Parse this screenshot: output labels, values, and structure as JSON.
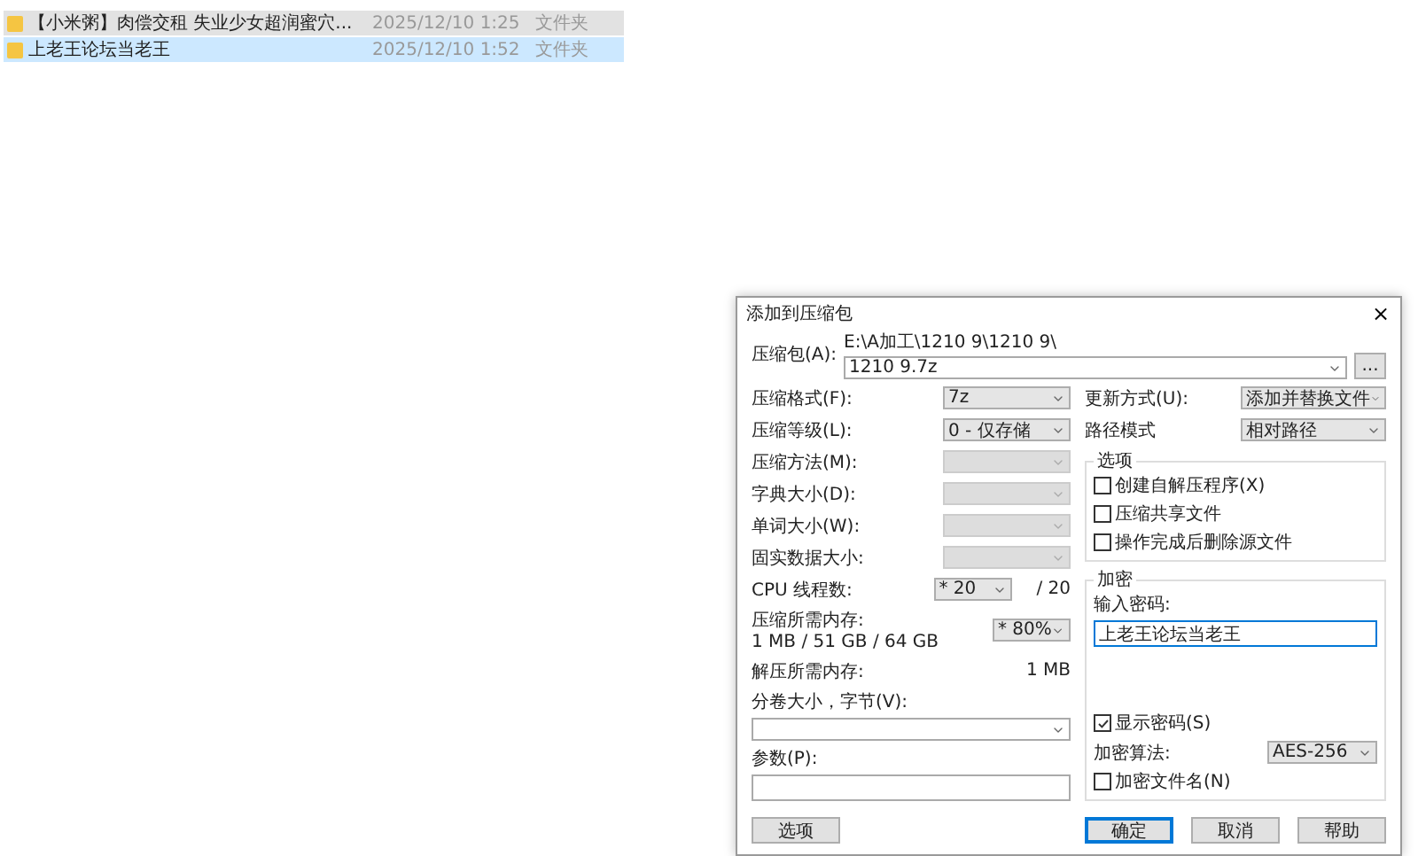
{
  "file_list": {
    "rows": [
      {
        "name": "【小米粥】肉偿交租 失业少女超润蜜穴...",
        "date": "2025/12/10 1:25",
        "type": "文件夹",
        "selected": false,
        "hovered": true
      },
      {
        "name": "上老王论坛当老王",
        "date": "2025/12/10 1:52",
        "type": "文件夹",
        "selected": true,
        "hovered": false
      }
    ]
  },
  "dialog": {
    "title": "添加到压缩包",
    "close": "×",
    "archive": {
      "label": "压缩包(A):",
      "path": "E:\\A加工\\1210 9\\1210 9\\",
      "value": "1210 9.7z",
      "browse": "..."
    },
    "left": [
      {
        "kind": "select",
        "label": "压缩格式(F):",
        "value": "7z",
        "disabled": false
      },
      {
        "kind": "select",
        "label": "压缩等级(L):",
        "value": "0 - 仅存储",
        "disabled": false
      },
      {
        "kind": "select",
        "label": "压缩方法(M):",
        "disabled": true
      },
      {
        "kind": "select",
        "label": "字典大小(D):",
        "disabled": true
      },
      {
        "kind": "select",
        "label": "单词大小(W):",
        "disabled": true
      },
      {
        "kind": "select",
        "label": "固实数据大小:",
        "disabled": true
      },
      {
        "kind": "threads",
        "label": "CPU 线程数:",
        "value": "* 20",
        "suffix": "/ 20"
      },
      {
        "kind": "memory",
        "label": "压缩所需内存:",
        "detail": "1 MB / 51 GB / 64 GB",
        "value": "* 80%"
      },
      {
        "kind": "info",
        "label": "解压所需内存:",
        "value": "1 MB"
      },
      {
        "kind": "combo",
        "label": "分卷大小，字节(V):"
      },
      {
        "kind": "text",
        "label": "参数(P):"
      }
    ],
    "right": {
      "selects": [
        {
          "label": "更新方式(U):",
          "value": "添加并替换文件"
        },
        {
          "label": "路径模式",
          "value": "相对路径"
        }
      ],
      "options": {
        "title": "选项",
        "checkboxes": [
          {
            "label": "创建自解压程序(X)",
            "checked": false
          },
          {
            "label": "压缩共享文件",
            "checked": false
          },
          {
            "label": "操作完成后删除源文件",
            "checked": false
          }
        ]
      },
      "encryption": {
        "title": "加密",
        "password_label": "输入密码:",
        "password": "上老王论坛当老王",
        "show_password": {
          "label": "显示密码(S)",
          "checked": true
        },
        "method": {
          "label": "加密算法:",
          "value": "AES-256"
        },
        "encrypt_names": {
          "label": "加密文件名(N)",
          "checked": false
        }
      }
    },
    "options_button": "选项",
    "buttons": [
      {
        "label": "确定",
        "default": true
      },
      {
        "label": "取消",
        "default": false
      },
      {
        "label": "帮助",
        "default": false
      }
    ]
  }
}
